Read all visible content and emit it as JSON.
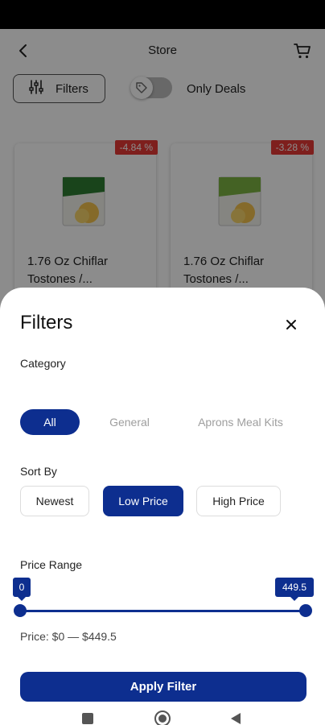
{
  "appbar": {
    "title": "Store"
  },
  "filter_bar": {
    "filters_label": "Filters",
    "only_deals_label": "Only Deals",
    "only_deals_on": false
  },
  "products": [
    {
      "discount": "-4.84 %",
      "name": "1.76 Oz Chiflar Tostones /..."
    },
    {
      "discount": "-3.28 %",
      "name": "1.76 Oz Chiflar Tostones /..."
    }
  ],
  "sheet": {
    "title": "Filters",
    "category": {
      "label": "Category",
      "tabs": [
        "All",
        "General",
        "Aprons Meal Kits"
      ],
      "selected": "All"
    },
    "sort": {
      "label": "Sort By",
      "options": [
        "Newest",
        "Low Price",
        "High Price"
      ],
      "selected": "Low Price"
    },
    "price_range": {
      "label": "Price Range",
      "min_label": "0",
      "max_label": "449.5",
      "min": 0,
      "max": 449.5,
      "summary": "Price: $0 — $449.5"
    },
    "apply_label": "Apply Filter"
  },
  "colors": {
    "primary": "#0d2e8f",
    "badge": "#e53935"
  },
  "icons": [
    "back-arrow-icon",
    "cart-icon",
    "sliders-icon",
    "tag-icon",
    "close-icon",
    "square-nav-icon",
    "circle-home-icon",
    "triangle-back-icon"
  ]
}
